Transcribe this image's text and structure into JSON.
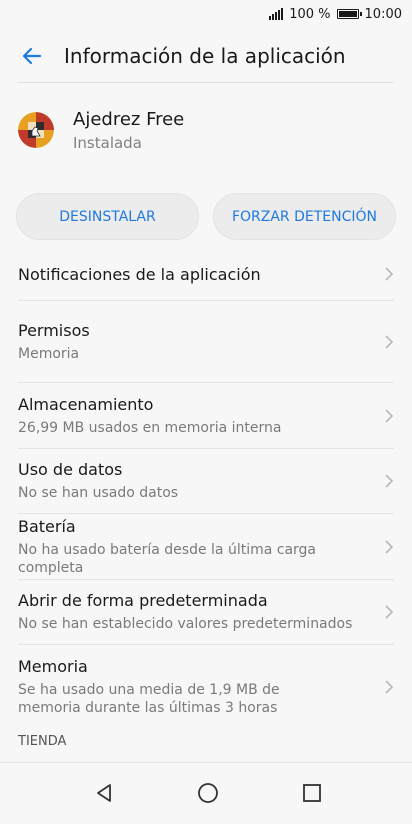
{
  "status_bar": {
    "battery": "100 %",
    "time": "10:00",
    "icons": [
      "signal-icon",
      "battery-icon"
    ]
  },
  "header": {
    "title": "Información de la aplicación",
    "back_icon": "arrow-left-icon"
  },
  "app": {
    "name": "Ajedrez Free",
    "status": "Instalada",
    "icon": "chess-app-icon"
  },
  "buttons": {
    "uninstall": "DESINSTALAR",
    "force_stop": "FORZAR DETENCIÓN"
  },
  "settings": [
    {
      "title": "Notificaciones de la aplicación",
      "subtitle": ""
    },
    {
      "title": "Permisos",
      "subtitle": "Memoria"
    },
    {
      "title": "Almacenamiento",
      "subtitle": "26,99 MB usados en memoria interna"
    },
    {
      "title": "Uso de datos",
      "subtitle": "No se han usado datos"
    },
    {
      "title": "Batería",
      "subtitle": "No ha usado batería desde la última carga completa"
    },
    {
      "title": "Abrir de forma predeterminada",
      "subtitle": "No se han establecido valores predeterminados"
    },
    {
      "title": "Memoria",
      "subtitle": "Se ha usado una media de 1,9 MB de memoria durante las últimas 3 horas"
    }
  ],
  "section": {
    "store": "TIENDA"
  },
  "colors": {
    "accent": "#1f7ae0",
    "background": "#f7f7f7",
    "button_bg": "#ececec"
  },
  "nav": {
    "icons": [
      "back-triangle-icon",
      "home-circle-icon",
      "recents-square-icon"
    ]
  }
}
